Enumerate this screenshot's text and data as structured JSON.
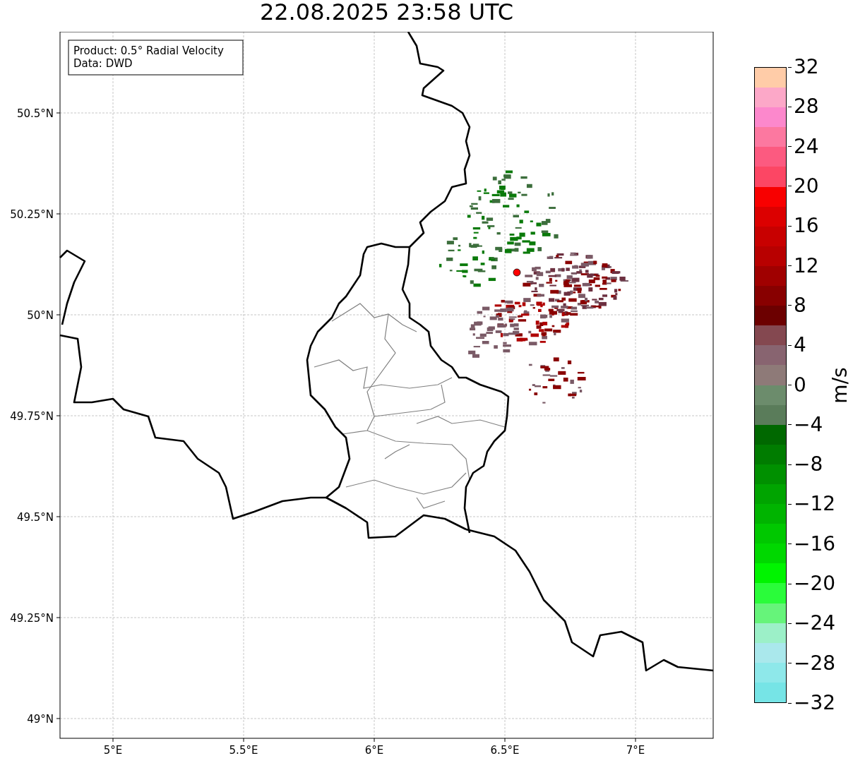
{
  "title": "22.08.2025 23:58 UTC",
  "map": {
    "info_box": [
      "Product: 0.5° Radial Velocity",
      "Data: DWD"
    ],
    "lat_ticks": [
      "50.5°N",
      "50.25°N",
      "50°N",
      "49.75°N",
      "49.5°N",
      "49.25°N",
      "49°N"
    ],
    "lon_ticks": [
      "5°E",
      "5.5°E",
      "6°E",
      "6.5°E",
      "7°E"
    ]
  },
  "colorbar": {
    "label": "m/s",
    "ticks": [
      "32",
      "28",
      "24",
      "20",
      "16",
      "12",
      "8",
      "4",
      "0",
      "−4",
      "−8",
      "−12",
      "−16",
      "−20",
      "−24",
      "−28",
      "−32"
    ],
    "bands": [
      {
        "color": "#ffcca8"
      },
      {
        "color": "#fca8c8"
      },
      {
        "color": "#fc88cc"
      },
      {
        "color": "#fc78a0"
      },
      {
        "color": "#fc5a80"
      },
      {
        "color": "#fc4664"
      },
      {
        "color": "#f80000"
      },
      {
        "color": "#dc0000"
      },
      {
        "color": "#c80000"
      },
      {
        "color": "#b80000"
      },
      {
        "color": "#a00000"
      },
      {
        "color": "#880000"
      },
      {
        "color": "#6c0000"
      },
      {
        "color": "#844850"
      },
      {
        "color": "#886470"
      },
      {
        "color": "#8e7a78"
      },
      {
        "color": "#6c8c6c"
      },
      {
        "color": "#5a7c5a"
      },
      {
        "color": "#006800"
      },
      {
        "color": "#007c00"
      },
      {
        "color": "#009000"
      },
      {
        "color": "#00a400"
      },
      {
        "color": "#00b400"
      },
      {
        "color": "#00c800"
      },
      {
        "color": "#00d800"
      },
      {
        "color": "#00f400"
      },
      {
        "color": "#2afc3a"
      },
      {
        "color": "#66f47a"
      },
      {
        "color": "#9cf0c8"
      },
      {
        "color": "#aae8ec"
      },
      {
        "color": "#8ee8ea"
      },
      {
        "color": "#76e4e6"
      }
    ]
  }
}
